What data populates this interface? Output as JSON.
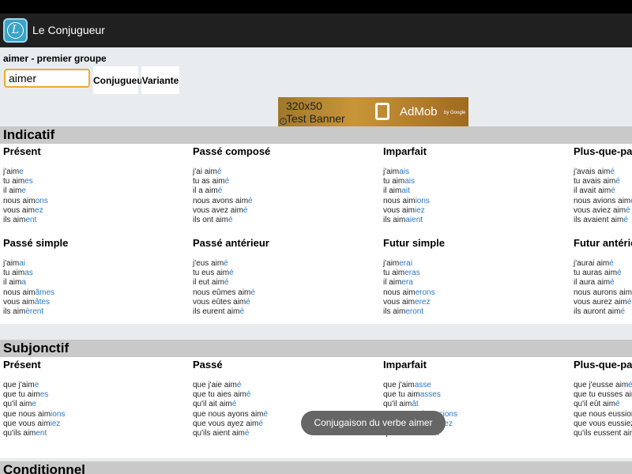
{
  "app": {
    "title": "Le Conjugueur",
    "icon_letter": "L"
  },
  "verb": {
    "heading": "aimer - premier groupe",
    "input_value": "aimer",
    "conjugate_label": "Conjugueur",
    "variant_label": "Variante"
  },
  "ad": {
    "line1": "320x50",
    "line2": "Test Banner",
    "brand": "AdMob",
    "sub": "by Google",
    "info": "i"
  },
  "sections": [
    {
      "title": "Indicatif",
      "tenses": [
        {
          "title": "Présent",
          "forms": [
            [
              "j'aim",
              "e"
            ],
            [
              "tu aim",
              "es"
            ],
            [
              "il aim",
              "e"
            ],
            [
              "nous aim",
              "ons"
            ],
            [
              "vous aim",
              "ez"
            ],
            [
              "ils aim",
              "ent"
            ]
          ]
        },
        {
          "title": "Passé composé",
          "forms": [
            [
              "j'ai aim",
              "é"
            ],
            [
              "tu as aim",
              "é"
            ],
            [
              "il a aim",
              "é"
            ],
            [
              "nous avons aim",
              "é"
            ],
            [
              "vous avez aim",
              "é"
            ],
            [
              "ils ont aim",
              "é"
            ]
          ]
        },
        {
          "title": "Imparfait",
          "forms": [
            [
              "j'aim",
              "ais"
            ],
            [
              "tu aim",
              "ais"
            ],
            [
              "il aim",
              "ait"
            ],
            [
              "nous aim",
              "ions"
            ],
            [
              "vous aim",
              "iez"
            ],
            [
              "ils aim",
              "aient"
            ]
          ]
        },
        {
          "title": "Plus-que-parfait",
          "forms": [
            [
              "j'avais aim",
              "é"
            ],
            [
              "tu avais aim",
              "é"
            ],
            [
              "il avait aim",
              "é"
            ],
            [
              "nous avions aim",
              "é"
            ],
            [
              "vous aviez aim",
              "é"
            ],
            [
              "ils avaient aim",
              "é"
            ]
          ]
        },
        {
          "title": "Passé simple",
          "forms": [
            [
              "j'aim",
              "ai"
            ],
            [
              "tu aim",
              "as"
            ],
            [
              "il aim",
              "a"
            ],
            [
              "nous aim",
              "âmes"
            ],
            [
              "vous aim",
              "âtes"
            ],
            [
              "ils aim",
              "èrent"
            ]
          ]
        },
        {
          "title": "Passé antérieur",
          "forms": [
            [
              "j'eus aim",
              "é"
            ],
            [
              "tu eus aim",
              "é"
            ],
            [
              "il eut aim",
              "é"
            ],
            [
              "nous eûmes aim",
              "é"
            ],
            [
              "vous eûtes aim",
              "é"
            ],
            [
              "ils eurent aim",
              "é"
            ]
          ]
        },
        {
          "title": "Futur simple",
          "forms": [
            [
              "j'aim",
              "erai"
            ],
            [
              "tu aim",
              "eras"
            ],
            [
              "il aim",
              "era"
            ],
            [
              "nous aim",
              "erons"
            ],
            [
              "vous aim",
              "erez"
            ],
            [
              "ils aim",
              "eront"
            ]
          ]
        },
        {
          "title": "Futur antérieur",
          "forms": [
            [
              "j'aurai aim",
              "é"
            ],
            [
              "tu auras aim",
              "é"
            ],
            [
              "il aura aim",
              "é"
            ],
            [
              "nous aurons aim",
              "é"
            ],
            [
              "vous aurez aim",
              "é"
            ],
            [
              "ils auront aim",
              "é"
            ]
          ]
        }
      ]
    },
    {
      "title": "Subjonctif",
      "tenses": [
        {
          "title": "Présent",
          "forms": [
            [
              "que j'aim",
              "e"
            ],
            [
              "que tu aim",
              "es"
            ],
            [
              "qu'il aim",
              "e"
            ],
            [
              "que nous aim",
              "ions"
            ],
            [
              "que vous aim",
              "iez"
            ],
            [
              "qu'ils aim",
              "ent"
            ]
          ]
        },
        {
          "title": "Passé",
          "forms": [
            [
              "que j'aie aim",
              "é"
            ],
            [
              "que tu aies aim",
              "é"
            ],
            [
              "qu'il ait aim",
              "é"
            ],
            [
              "que nous ayons aim",
              "é"
            ],
            [
              "que vous ayez aim",
              "é"
            ],
            [
              "qu'ils aient aim",
              "é"
            ]
          ]
        },
        {
          "title": "Imparfait",
          "forms": [
            [
              "que j'aim",
              "asse"
            ],
            [
              "que tu aim",
              "asses"
            ],
            [
              "qu'il aim",
              "ât"
            ],
            [
              "que nous aim",
              "assions"
            ],
            [
              "que vous aim",
              "assiez"
            ],
            [
              "qu'ils aim",
              "assent"
            ]
          ]
        },
        {
          "title": "Plus-que-parfait",
          "forms": [
            [
              "que j'eusse aim",
              "é"
            ],
            [
              "que tu eusses aim",
              "é"
            ],
            [
              "qu'il eût aim",
              "é"
            ],
            [
              "que nous eussions aim",
              "é"
            ],
            [
              "que vous eussiez aim",
              "é"
            ],
            [
              "qu'ils eussent aim",
              "é"
            ]
          ]
        }
      ]
    },
    {
      "title": "Conditionnel",
      "tenses": []
    }
  ],
  "toast": {
    "message": "Conjugaison du verbe aimer"
  },
  "colors": {
    "accent": "#2a78c8",
    "input_border": "#f0a830",
    "app_bar": "#202020"
  }
}
